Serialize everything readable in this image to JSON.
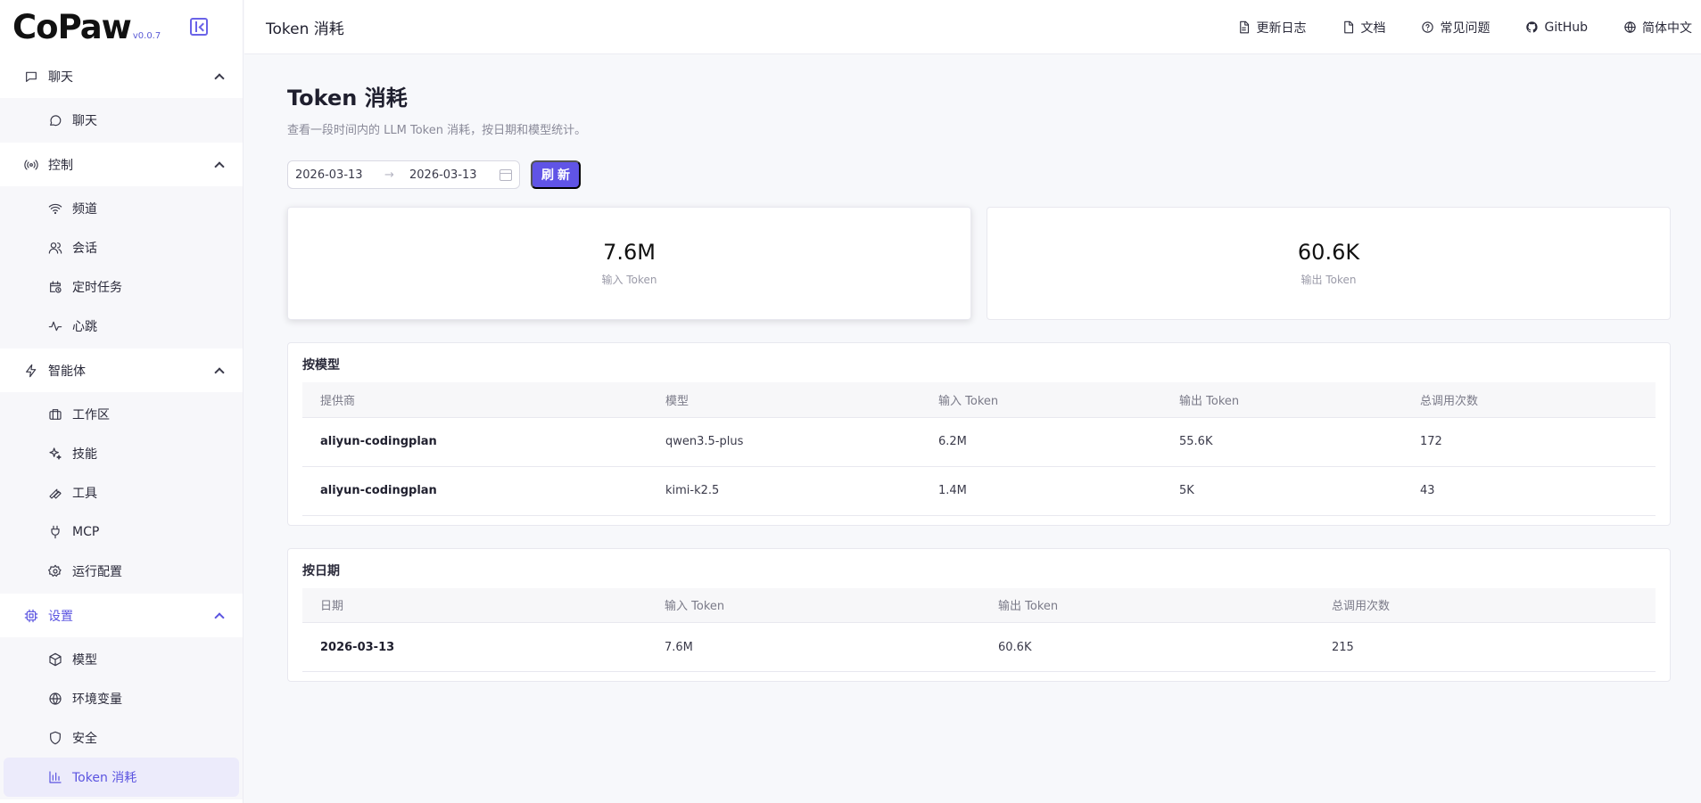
{
  "app": {
    "logo": "CoPaw",
    "version": "v0.0.7"
  },
  "sidebar": {
    "groups": [
      {
        "label": "聊天",
        "items": [
          {
            "label": "聊天"
          }
        ]
      },
      {
        "label": "控制",
        "items": [
          {
            "label": "频道"
          },
          {
            "label": "会话"
          },
          {
            "label": "定时任务"
          },
          {
            "label": "心跳"
          }
        ]
      },
      {
        "label": "智能体",
        "items": [
          {
            "label": "工作区"
          },
          {
            "label": "技能"
          },
          {
            "label": "工具"
          },
          {
            "label": "MCP"
          },
          {
            "label": "运行配置"
          }
        ]
      },
      {
        "label": "设置",
        "items": [
          {
            "label": "模型"
          },
          {
            "label": "环境变量"
          },
          {
            "label": "安全"
          },
          {
            "label": "Token 消耗"
          }
        ]
      }
    ]
  },
  "header": {
    "title": "Token 消耗",
    "links": {
      "changelog": "更新日志",
      "docs": "文档",
      "faq": "常见问题",
      "github": "GitHub",
      "language": "简体中文"
    }
  },
  "main": {
    "title": "Token 消耗",
    "description": "查看一段时间内的 LLM Token 消耗，按日期和模型统计。",
    "date_range": {
      "start": "2026-03-13",
      "separator": "→",
      "end": "2026-03-13"
    },
    "refresh_label": "刷新",
    "summary": {
      "input": {
        "value": "7.6M",
        "label": "输入 Token"
      },
      "output": {
        "value": "60.6K",
        "label": "输出 Token"
      }
    },
    "by_model": {
      "title": "按模型",
      "headers": {
        "provider": "提供商",
        "model": "模型",
        "input": "输入 Token",
        "output": "输出 Token",
        "calls": "总调用次数"
      },
      "rows": [
        {
          "provider": "aliyun-codingplan",
          "model": "qwen3.5-plus",
          "input": "6.2M",
          "output": "55.6K",
          "calls": "172"
        },
        {
          "provider": "aliyun-codingplan",
          "model": "kimi-k2.5",
          "input": "1.4M",
          "output": "5K",
          "calls": "43"
        }
      ]
    },
    "by_date": {
      "title": "按日期",
      "headers": {
        "date": "日期",
        "input": "输入 Token",
        "output": "输出 Token",
        "calls": "总调用次数"
      },
      "rows": [
        {
          "date": "2026-03-13",
          "input": "7.6M",
          "output": "60.6K",
          "calls": "215"
        }
      ]
    }
  },
  "colors": {
    "accent": "#6054e6",
    "active_bg": "#ecebfb",
    "logo_dots": "#f5a623"
  }
}
